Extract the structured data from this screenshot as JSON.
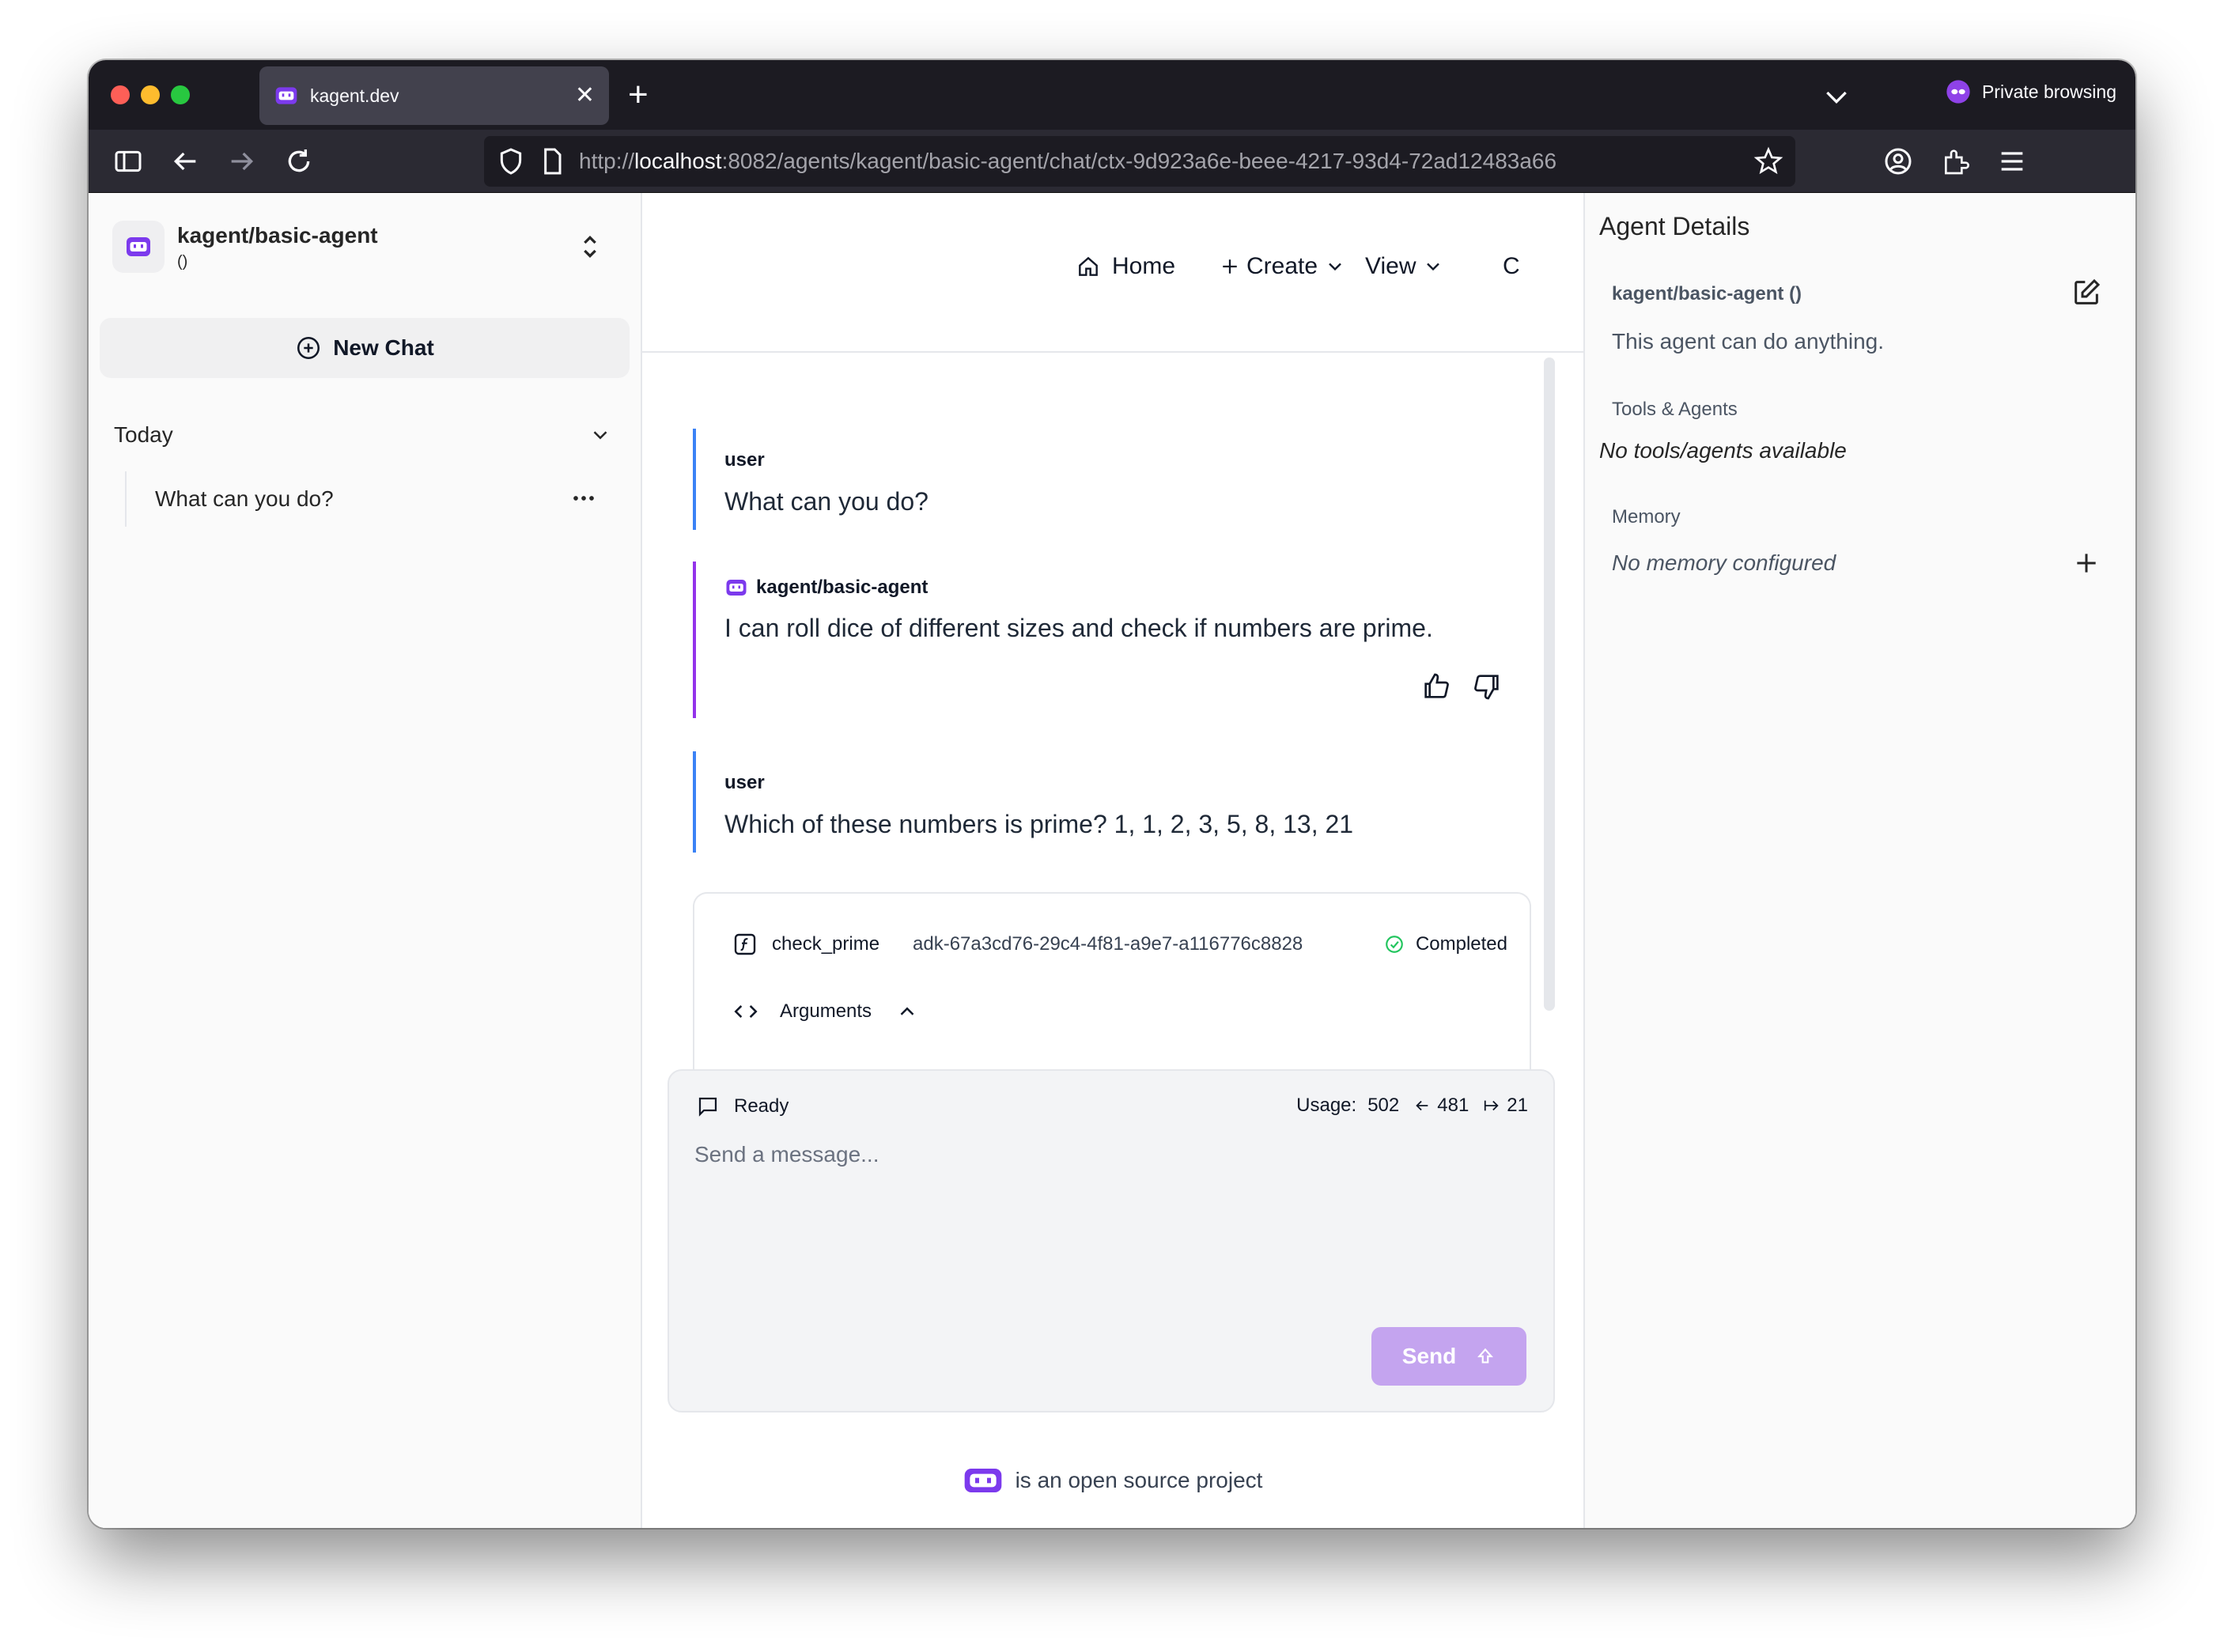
{
  "browser": {
    "tab_title": "kagent.dev",
    "private_label": "Private browsing",
    "url_prefix": "http://",
    "url_host": "localhost",
    "url_rest": ":8082/agents/kagent/basic-agent/chat/ctx-9d923a6e-beee-4217-93d4-72ad12483a66"
  },
  "sidebar": {
    "agent_name": "kagent/basic-agent",
    "agent_sub": "()",
    "new_chat_label": "New Chat",
    "group_label": "Today",
    "history": [
      {
        "title": "What can you do?"
      }
    ]
  },
  "topnav": {
    "home": "Home",
    "create": "Create",
    "view": "View",
    "partial": "C"
  },
  "messages": [
    {
      "role": "user",
      "text": "What can you do?"
    },
    {
      "role": "kagent/basic-agent",
      "text": "I can roll dice of different sizes and check if numbers are prime."
    },
    {
      "role": "user",
      "text": "Which of these numbers is prime? 1, 1, 2, 3, 5, 8, 13, 21"
    }
  ],
  "tool_call": {
    "name": "check_prime",
    "id": "adk-67a3cd76-29c4-4f81-a9e7-a116776c8828",
    "status": "Completed",
    "args_label": "Arguments"
  },
  "composer": {
    "status": "Ready",
    "usage_label": "Usage:",
    "usage_total": "502",
    "usage_in": "481",
    "usage_out": "21",
    "placeholder": "Send a message...",
    "send_label": "Send"
  },
  "footer": {
    "text": "is an open source project"
  },
  "details": {
    "title": "Agent Details",
    "agent_name": "kagent/basic-agent ()",
    "description": "This agent can do anything.",
    "tools_label": "Tools & Agents",
    "tools_empty": "No tools/agents available",
    "memory_label": "Memory",
    "memory_empty": "No memory configured"
  },
  "colors": {
    "brand": "#7c3aed",
    "user_border": "#3b82f6",
    "agent_border": "#9333ea",
    "send_button": "#c4a4ef",
    "completed": "#22c55e"
  },
  "icons": [
    "robot-icon",
    "search-icon",
    "plus-circle-icon",
    "chevron-down-icon",
    "more-icon",
    "home-icon",
    "plus-icon",
    "thumbs-up-icon",
    "thumbs-down-icon",
    "function-icon",
    "check-circle-icon",
    "code-icon",
    "chevron-up-icon",
    "message-icon",
    "arrow-left-icon",
    "arrow-right-icon",
    "arrow-up-icon",
    "edit-icon"
  ]
}
